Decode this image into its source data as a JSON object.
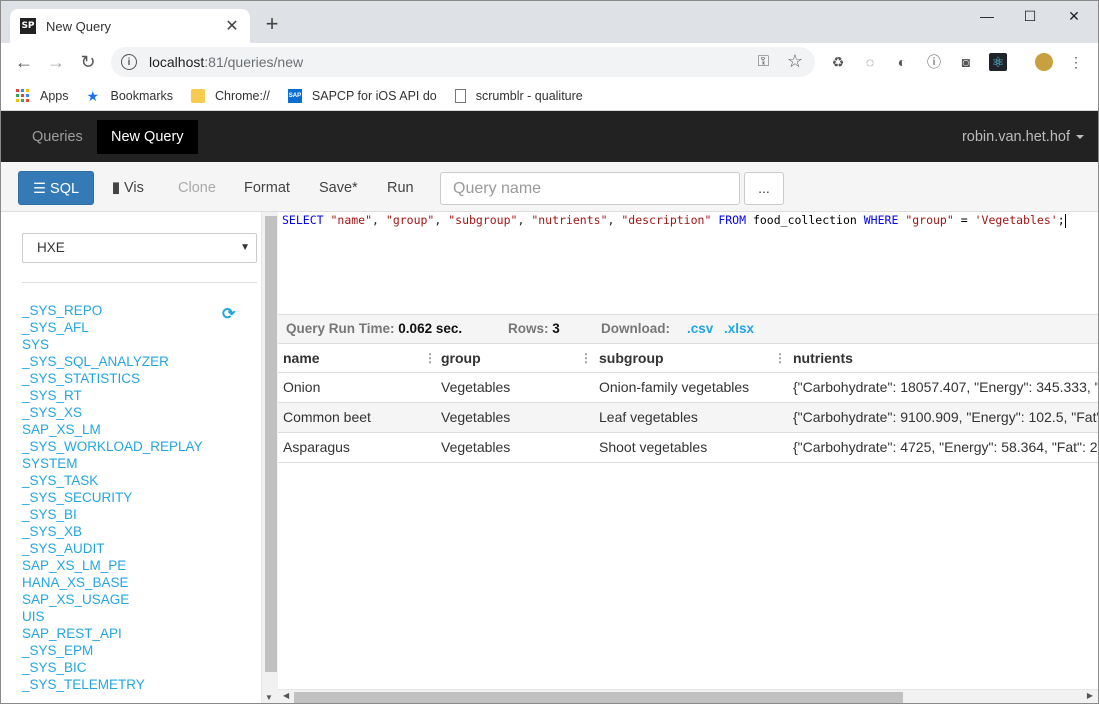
{
  "browser": {
    "tab_title": "New Query",
    "favicon_text": "SP",
    "url_host": "localhost",
    "url_rest": ":81/queries/new",
    "bookmarks": [
      "Apps",
      "Bookmarks",
      "Chrome://",
      "SAPCP for iOS API do",
      "scrumblr - qualiture"
    ]
  },
  "app": {
    "nav": {
      "queries": "Queries",
      "new_query": "New Query",
      "user": "robin.van.het.hof"
    },
    "toolbar": {
      "sql": "SQL",
      "vis": "Vis",
      "clone": "Clone",
      "format": "Format",
      "save": "Save*",
      "run": "Run",
      "query_name_placeholder": "Query name",
      "more": "..."
    },
    "database": "HXE",
    "schemas": [
      "_SYS_REPO",
      "_SYS_AFL",
      "SYS",
      "_SYS_SQL_ANALYZER",
      "_SYS_STATISTICS",
      "_SYS_RT",
      "_SYS_XS",
      "SAP_XS_LM",
      "_SYS_WORKLOAD_REPLAY",
      "SYSTEM",
      "_SYS_TASK",
      "_SYS_SECURITY",
      "_SYS_BI",
      "_SYS_XB",
      "_SYS_AUDIT",
      "SAP_XS_LM_PE",
      "HANA_XS_BASE",
      "SAP_XS_USAGE",
      "UIS",
      "SAP_REST_API",
      "_SYS_EPM",
      "_SYS_BIC",
      "_SYS_TELEMETRY"
    ],
    "sql": {
      "select": "SELECT",
      "cols": [
        "\"name\"",
        "\"group\"",
        "\"subgroup\"",
        "\"nutrients\"",
        "\"description\""
      ],
      "from": "FROM",
      "table": "food_collection",
      "where": "WHERE",
      "where_col": "\"group\"",
      "op": "=",
      "where_val": "'Vegetables'",
      "end": ";"
    },
    "run_info": {
      "time_label": "Query Run Time:",
      "time_value": "0.062 sec.",
      "rows_label": "Rows:",
      "rows_value": "3",
      "download_label": "Download:",
      "csv": ".csv",
      "xlsx": ".xlsx"
    },
    "results": {
      "columns": [
        "name",
        "group",
        "subgroup",
        "nutrients"
      ],
      "rows": [
        [
          "Onion",
          "Vegetables",
          "Onion-family vegetables",
          "{\"Carbohydrate\": 18057.407, \"Energy\": 345.333, \""
        ],
        [
          "Common beet",
          "Vegetables",
          "Leaf vegetables",
          "{\"Carbohydrate\": 9100.909, \"Energy\": 102.5, \"Fat\""
        ],
        [
          "Asparagus",
          "Vegetables",
          "Shoot vegetables",
          "{\"Carbohydrate\": 4725, \"Energy\": 58.364, \"Fat\": 2"
        ]
      ]
    }
  }
}
